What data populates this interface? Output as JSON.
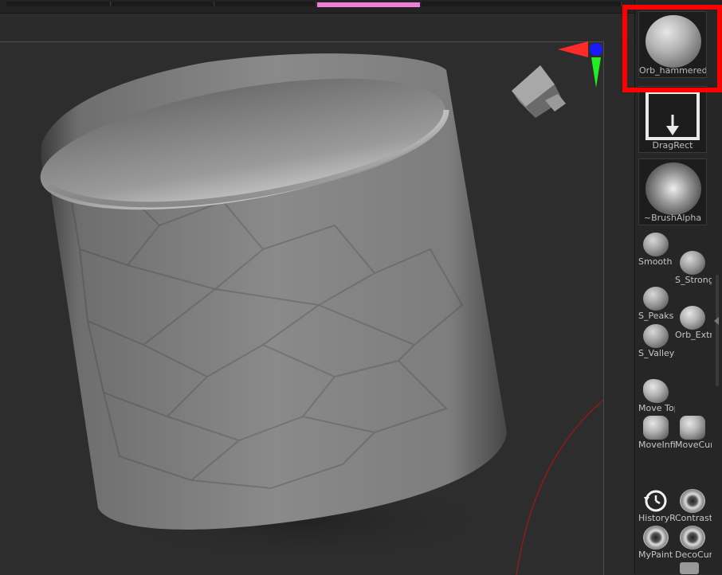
{
  "tray": {
    "selected_brush": "Orb_hammered",
    "stroke_label": "DragRect",
    "alpha_label": "~BrushAlpha",
    "brushes": [
      {
        "label": "Smooth",
        "icon": "smooth-brush-icon"
      },
      {
        "label": "S_Stronger",
        "icon": "smooth-stronger-brush-icon"
      },
      {
        "label": "S_Peaks",
        "icon": "smooth-peaks-brush-icon"
      },
      {
        "label": "Orb_Extruder",
        "icon": "orb-extruder-brush-icon"
      },
      {
        "label": "S_Valleys",
        "icon": "smooth-valleys-brush-icon"
      },
      {
        "label": "Move Topological",
        "icon": "move-topological-brush-icon"
      },
      {
        "label": "MoveInfinite",
        "icon": "move-infinite-brush-icon"
      },
      {
        "label": "MoveCurve",
        "icon": "move-curve-brush-icon"
      },
      {
        "label": "HistoryRecall",
        "icon": "history-recall-brush-icon"
      },
      {
        "label": "Contrast",
        "icon": "contrast-brush-icon"
      },
      {
        "label": "MyPaint",
        "icon": "my-paint-brush-icon"
      },
      {
        "label": "DecoCurve",
        "icon": "deco-curve-brush-icon"
      }
    ]
  },
  "viewport": {
    "model": "cylinder-mesh",
    "gizmo_colors": {
      "x": "#ff2a2a",
      "y": "#22ee22",
      "z": "#1a1aff"
    }
  },
  "colors": {
    "highlight": "#ff0000",
    "progress": "#ee7fd8",
    "background": "#2a2a2a"
  },
  "progress": {
    "value": 0.14
  }
}
